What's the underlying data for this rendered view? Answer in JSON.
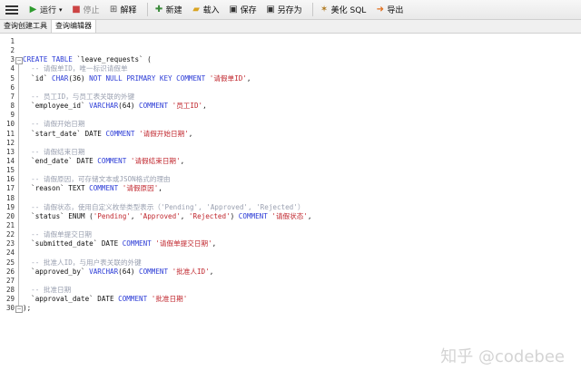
{
  "toolbar": {
    "run": "运行",
    "stop": "停止",
    "explain": "解释",
    "new": "新建",
    "load": "载入",
    "save": "保存",
    "save_as": "另存为",
    "beautify": "美化 SQL",
    "export": "导出"
  },
  "tabs": [
    "查询创建工具",
    "查询编辑器"
  ],
  "colors": {
    "keyword": "#2b3bd6",
    "comment": "#9aa0b0",
    "string": "#c0262d",
    "plain": "#111111"
  },
  "code_lines": [
    [],
    [],
    [
      {
        "t": "CREATE TABLE",
        "c": "kw"
      },
      {
        "t": " `leave_requests` (",
        "c": "pl"
      }
    ],
    [
      {
        "t": "  -- 请假单ID，唯一标识请假单",
        "c": "cm"
      }
    ],
    [
      {
        "t": "  `id` ",
        "c": "pl"
      },
      {
        "t": "CHAR",
        "c": "kw"
      },
      {
        "t": "(36) ",
        "c": "pl"
      },
      {
        "t": "NOT NULL PRIMARY KEY COMMENT",
        "c": "kw"
      },
      {
        "t": " ",
        "c": "pl"
      },
      {
        "t": "'请假单ID'",
        "c": "str"
      },
      {
        "t": ",",
        "c": "pl"
      }
    ],
    [],
    [
      {
        "t": "  -- 员工ID，与员工表关联的外键",
        "c": "cm"
      }
    ],
    [
      {
        "t": "  `employee_id` ",
        "c": "pl"
      },
      {
        "t": "VARCHAR",
        "c": "kw"
      },
      {
        "t": "(64) ",
        "c": "pl"
      },
      {
        "t": "COMMENT",
        "c": "kw"
      },
      {
        "t": " ",
        "c": "pl"
      },
      {
        "t": "'员工ID'",
        "c": "str"
      },
      {
        "t": ",",
        "c": "pl"
      }
    ],
    [],
    [
      {
        "t": "  -- 请假开始日期",
        "c": "cm"
      }
    ],
    [
      {
        "t": "  `start_date` DATE ",
        "c": "pl"
      },
      {
        "t": "COMMENT",
        "c": "kw"
      },
      {
        "t": " ",
        "c": "pl"
      },
      {
        "t": "'请假开始日期'",
        "c": "str"
      },
      {
        "t": ",",
        "c": "pl"
      }
    ],
    [],
    [
      {
        "t": "  -- 请假结束日期",
        "c": "cm"
      }
    ],
    [
      {
        "t": "  `end_date` DATE ",
        "c": "pl"
      },
      {
        "t": "COMMENT",
        "c": "kw"
      },
      {
        "t": " ",
        "c": "pl"
      },
      {
        "t": "'请假结束日期'",
        "c": "str"
      },
      {
        "t": ",",
        "c": "pl"
      }
    ],
    [],
    [
      {
        "t": "  -- 请假原因，可存储文本或JSON格式的理由",
        "c": "cm"
      }
    ],
    [
      {
        "t": "  `reason` TEXT ",
        "c": "pl"
      },
      {
        "t": "COMMENT",
        "c": "kw"
      },
      {
        "t": " ",
        "c": "pl"
      },
      {
        "t": "'请假原因'",
        "c": "str"
      },
      {
        "t": ",",
        "c": "pl"
      }
    ],
    [],
    [
      {
        "t": "  -- 请假状态，使用自定义枚举类型表示（'Pending', 'Approved', 'Rejected'）",
        "c": "cm"
      }
    ],
    [
      {
        "t": "  `status` ENUM (",
        "c": "pl"
      },
      {
        "t": "'Pending'",
        "c": "str"
      },
      {
        "t": ", ",
        "c": "pl"
      },
      {
        "t": "'Approved'",
        "c": "str"
      },
      {
        "t": ", ",
        "c": "pl"
      },
      {
        "t": "'Rejected'",
        "c": "str"
      },
      {
        "t": ") ",
        "c": "pl"
      },
      {
        "t": "COMMENT",
        "c": "kw"
      },
      {
        "t": " ",
        "c": "pl"
      },
      {
        "t": "'请假状态'",
        "c": "str"
      },
      {
        "t": ",",
        "c": "pl"
      }
    ],
    [],
    [
      {
        "t": "  -- 请假单提交日期",
        "c": "cm"
      }
    ],
    [
      {
        "t": "  `submitted_date` DATE ",
        "c": "pl"
      },
      {
        "t": "COMMENT",
        "c": "kw"
      },
      {
        "t": " ",
        "c": "pl"
      },
      {
        "t": "'请假单提交日期'",
        "c": "str"
      },
      {
        "t": ",",
        "c": "pl"
      }
    ],
    [],
    [
      {
        "t": "  -- 批准人ID，与用户表关联的外键",
        "c": "cm"
      }
    ],
    [
      {
        "t": "  `approved_by` ",
        "c": "pl"
      },
      {
        "t": "VARCHAR",
        "c": "kw"
      },
      {
        "t": "(64) ",
        "c": "pl"
      },
      {
        "t": "COMMENT",
        "c": "kw"
      },
      {
        "t": " ",
        "c": "pl"
      },
      {
        "t": "'批准人ID'",
        "c": "str"
      },
      {
        "t": ",",
        "c": "pl"
      }
    ],
    [],
    [
      {
        "t": "  -- 批准日期",
        "c": "cm"
      }
    ],
    [
      {
        "t": "  `approval_date` DATE ",
        "c": "pl"
      },
      {
        "t": "COMMENT",
        "c": "kw"
      },
      {
        "t": " ",
        "c": "pl"
      },
      {
        "t": "'批准日期'",
        "c": "str"
      }
    ],
    [
      {
        "t": ");",
        "c": "pl"
      }
    ]
  ],
  "watermark": "知乎 @codebee"
}
